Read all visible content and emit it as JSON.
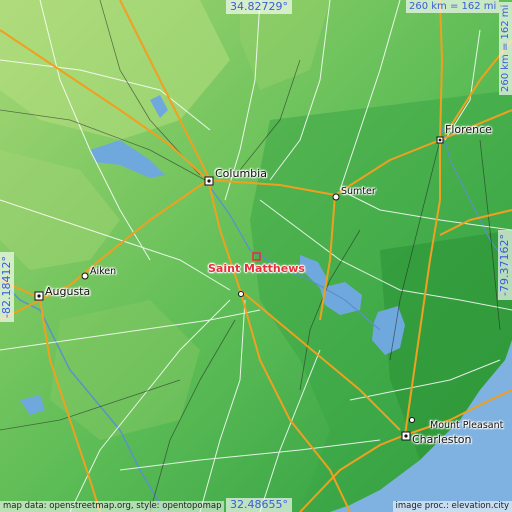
{
  "map": {
    "place": "Saint Matthews",
    "coords": {
      "top": "34.82729°",
      "bottom": "32.48655°",
      "left": "-82.18412°",
      "right": "-79.37162°"
    },
    "scale": {
      "horizontal": "260 km = 162 mi",
      "vertical": "260 km = 162 mi"
    },
    "cities": [
      {
        "name": "Florence"
      },
      {
        "name": "Columbia"
      },
      {
        "name": "Sumter"
      },
      {
        "name": "Aiken"
      },
      {
        "name": "Augusta"
      },
      {
        "name": "Charleston"
      },
      {
        "name": "Mount Pleasant"
      }
    ],
    "credits": {
      "left": "map data: openstreetmap.org, style: opentopomap",
      "right": "image proc.: elevation.city"
    },
    "colors": {
      "land_low": "#2f9a3a",
      "land_mid": "#66c45a",
      "land_high": "#b5dc7a",
      "water": "#6fa8dc",
      "ocean": "#7fb2e0",
      "highway": "#f0a020",
      "road": "#ffffff",
      "marker": "#e8303a"
    }
  }
}
